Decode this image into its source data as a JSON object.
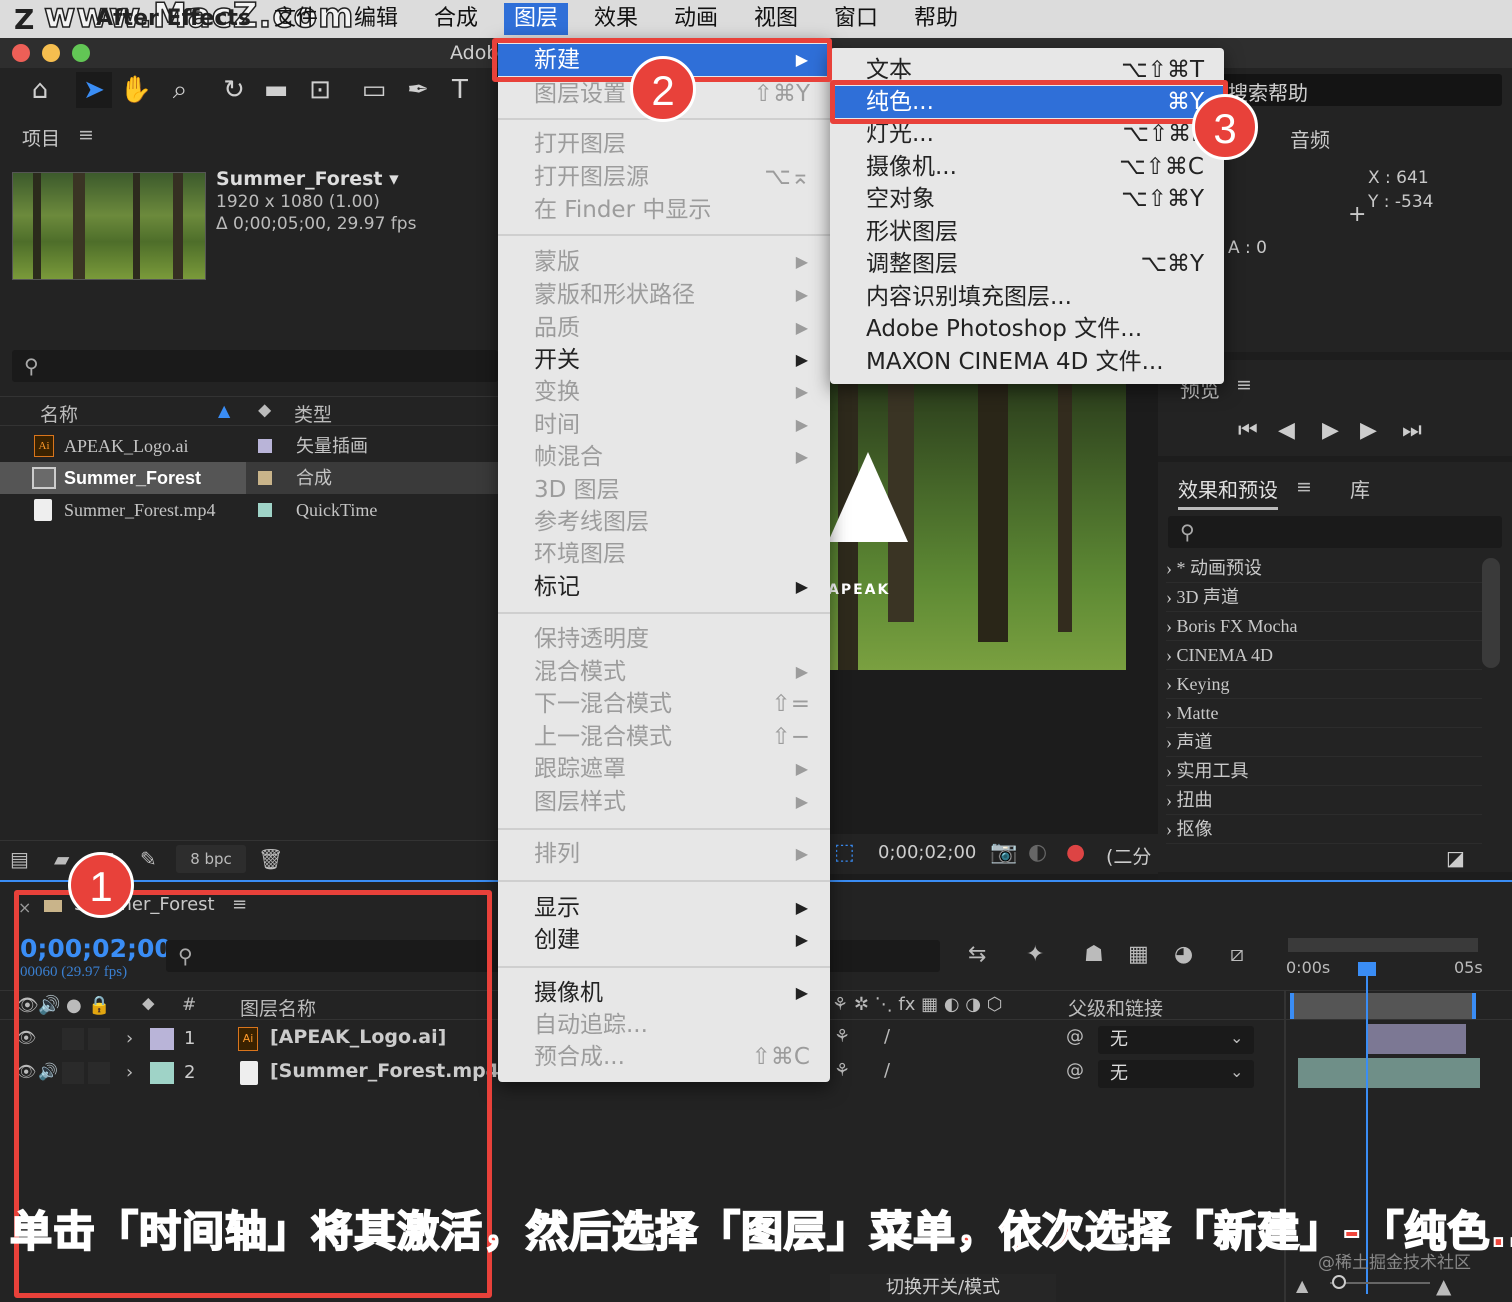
{
  "menubar": {
    "app": "After Effects",
    "watermark": "www.MacZ.com",
    "items": [
      "文件",
      "编辑",
      "合成",
      "图层",
      "效果",
      "动画",
      "视图",
      "窗口",
      "帮助"
    ],
    "active": "图层"
  },
  "titlebar": {
    "text": "Adob"
  },
  "project": {
    "title": "项目",
    "comp_name": "Summer_Forest ▾",
    "comp_size": "1920 x 1080 (1.00)",
    "comp_duration": "Δ 0;00;05;00, 29.97 fps",
    "col_name": "名称",
    "col_type": "类型",
    "rows": [
      {
        "name": "APEAK_Logo.ai",
        "type": "矢量插画",
        "color": "#b9b4d8"
      },
      {
        "name": "Summer_Forest",
        "type": "合成",
        "color": "#c9b48a"
      },
      {
        "name": "Summer_Forest.mp4",
        "type": "QuickTime",
        "color": "#9fd3c7"
      }
    ],
    "bpc": "8 bpc"
  },
  "layer_menu": {
    "new": "新建",
    "items": [
      {
        "label": "图层设置",
        "sc": "⇧⌘Y",
        "dis": true
      },
      {
        "label": "打开图层",
        "dis": true
      },
      {
        "label": "打开图层源",
        "sc": "⌥⌅",
        "dis": true
      },
      {
        "label": "在 Finder 中显示",
        "dis": true
      },
      {
        "label": "蒙版",
        "arrow": true,
        "dis": true
      },
      {
        "label": "蒙版和形状路径",
        "arrow": true,
        "dis": true
      },
      {
        "label": "品质",
        "arrow": true,
        "dis": true
      },
      {
        "label": "开关",
        "arrow": true,
        "dis": false
      },
      {
        "label": "变换",
        "arrow": true,
        "dis": true
      },
      {
        "label": "时间",
        "arrow": true,
        "dis": true
      },
      {
        "label": "帧混合",
        "arrow": true,
        "dis": true
      },
      {
        "label": "3D 图层",
        "dis": true
      },
      {
        "label": "参考线图层",
        "dis": true
      },
      {
        "label": "环境图层",
        "dis": true
      },
      {
        "label": "标记",
        "arrow": true,
        "dis": false
      },
      {
        "label": "保持透明度",
        "dis": true
      },
      {
        "label": "混合模式",
        "arrow": true,
        "dis": true
      },
      {
        "label": "下一混合模式",
        "sc": "⇧=",
        "dis": true
      },
      {
        "label": "上一混合模式",
        "sc": "⇧−",
        "dis": true
      },
      {
        "label": "跟踪遮罩",
        "arrow": true,
        "dis": true
      },
      {
        "label": "图层样式",
        "arrow": true,
        "dis": true
      },
      {
        "label": "排列",
        "arrow": true,
        "dis": true
      },
      {
        "label": "显示",
        "arrow": true,
        "dis": false
      },
      {
        "label": "创建",
        "arrow": true,
        "dis": false
      },
      {
        "label": "摄像机",
        "arrow": true,
        "dis": false
      },
      {
        "label": "自动追踪...",
        "dis": true
      },
      {
        "label": "预合成...",
        "sc": "⇧⌘C",
        "dis": true
      }
    ]
  },
  "new_submenu": {
    "items": [
      {
        "label": "文本",
        "sc": "⌥⇧⌘T"
      },
      {
        "label": "纯色...",
        "sc": "⌘Y"
      },
      {
        "label": "灯光...",
        "sc": "⌥⇧⌘L"
      },
      {
        "label": "摄像机...",
        "sc": "⌥⇧⌘C"
      },
      {
        "label": "空对象",
        "sc": "⌥⇧⌘Y"
      },
      {
        "label": "形状图层",
        "sc": ""
      },
      {
        "label": "调整图层",
        "sc": "⌥⌘Y"
      },
      {
        "label": "内容识别填充图层...",
        "sc": ""
      },
      {
        "label": "Adobe Photoshop 文件...",
        "sc": ""
      },
      {
        "label": "MAXON CINEMA 4D 文件...",
        "sc": ""
      }
    ]
  },
  "right": {
    "search_help": "搜索帮助",
    "audio": "音频",
    "info_x": "X : 641",
    "info_y": "Y : -534",
    "info_a": "A : 0",
    "preview": "预览",
    "effects_title": "效果和预设",
    "library": "库",
    "effects": [
      "* 动画预设",
      "3D 声道",
      "Boris FX Mocha",
      "CINEMA 4D",
      "Keying",
      "Matte",
      "声道",
      "实用工具",
      "扭曲",
      "抠像"
    ]
  },
  "viewer": {
    "timecode": "0;00;02;00",
    "zoom": "(二分",
    "logo_text": "APEAK"
  },
  "timeline": {
    "comp_tab": "Summer_Forest",
    "timecode": "0;00;02;00",
    "frames": "00060 (29.97 fps)",
    "col_num": "#",
    "col_layer": "图层名称",
    "col_parent": "父级和链接",
    "ruler_start": "0:00s",
    "ruler_end": "05s",
    "layers": [
      {
        "num": "1",
        "name": "[APEAK_Logo.ai]",
        "color": "#b9b4d8",
        "parent": "无"
      },
      {
        "num": "2",
        "name": "[Summer_Forest.mp4]",
        "color": "#9fd3c7",
        "parent": "无"
      }
    ],
    "toggle_label": "切换开关/模式"
  },
  "badges": [
    "1",
    "2",
    "3"
  ],
  "caption": "单击「时间轴」将其激活，然后选择「图层」菜单，依次选择「新建」-「纯色...」",
  "credit": "@稀土掘金技术社区"
}
